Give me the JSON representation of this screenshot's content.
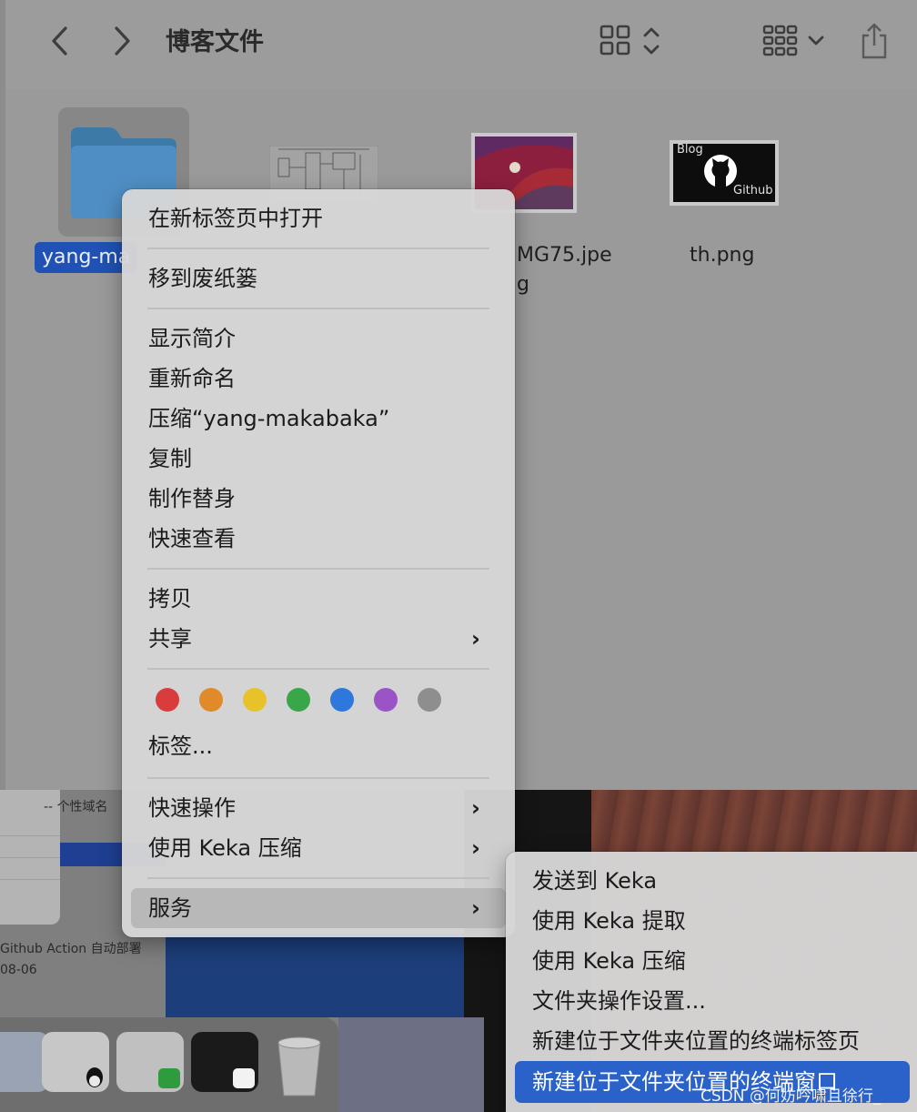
{
  "window": {
    "title": "博客文件"
  },
  "toolbar": {
    "back_icon": "chevron-left-icon",
    "forward_icon": "chevron-right-icon",
    "view_icon": "grid-view-icon",
    "group_icon": "group-by-icon",
    "share_icon": "share-icon"
  },
  "files": [
    {
      "name": "yang-ma",
      "kind": "folder",
      "selected": true
    },
    {
      "name": "",
      "kind": "diagram-thumbnail"
    },
    {
      "name_line1": "MG75.jpe",
      "name_line2": "g",
      "kind": "image-thumbnail"
    },
    {
      "name": "th.png",
      "kind": "image-thumbnail",
      "thumb_text_top": "Blog",
      "thumb_text_bottom": "Github"
    }
  ],
  "context_menu": {
    "open_new_tab": "在新标签页中打开",
    "move_to_trash": "移到废纸篓",
    "get_info": "显示简介",
    "rename": "重新命名",
    "compress": "压缩“yang-makabaka”",
    "duplicate": "复制",
    "make_alias": "制作替身",
    "quick_look": "快速查看",
    "copy": "拷贝",
    "share": "共享",
    "tag_colors": [
      "#d93c3c",
      "#e08a2a",
      "#e8c22a",
      "#3aa64a",
      "#2f78db",
      "#9a54c6",
      "#8e8e8e"
    ],
    "tags": "标签...",
    "quick_actions": "快速操作",
    "keka_compress": "使用 Keka 压缩",
    "services": "服务"
  },
  "services_submenu": {
    "items": [
      "发送到 Keka",
      "使用 Keka 提取",
      "使用 Keka 压缩",
      "文件夹操作设置...",
      "新建位于文件夹位置的终端标签页",
      "新建位于文件夹位置的终端窗口"
    ],
    "highlighted_index": 5
  },
  "background": {
    "text_personal_domain": "个性域名",
    "text_github_action": "Github Action 自动部署",
    "text_date": "08-06"
  },
  "watermark": "CSDN @何妨吟啸且徐行_"
}
